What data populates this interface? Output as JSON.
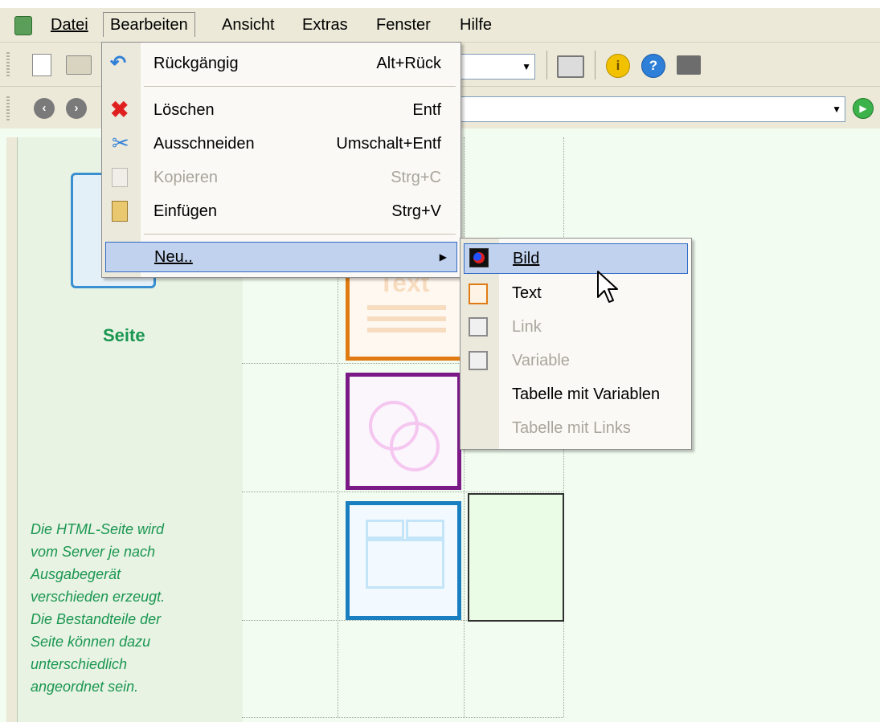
{
  "menubar": {
    "items": [
      {
        "label": "Datei"
      },
      {
        "label": "Bearbeiten"
      },
      {
        "label": "Ansicht"
      },
      {
        "label": "Extras"
      },
      {
        "label": "Fenster"
      },
      {
        "label": "Hilfe"
      }
    ]
  },
  "edit_menu": {
    "items": [
      {
        "label": "Rückgängig",
        "shortcut": "Alt+Rück",
        "icon": "undo-icon"
      },
      {
        "label": "Löschen",
        "shortcut": "Entf",
        "icon": "delete-icon"
      },
      {
        "label": "Ausschneiden",
        "shortcut": "Umschalt+Entf",
        "icon": "cut-icon"
      },
      {
        "label": "Kopieren",
        "shortcut": "Strg+C",
        "icon": "copy-icon",
        "disabled": true
      },
      {
        "label": "Einfügen",
        "shortcut": "Strg+V",
        "icon": "paste-icon"
      },
      {
        "label": "Neu..",
        "submenu_arrow": "▶"
      }
    ]
  },
  "new_submenu": {
    "items": [
      {
        "label": "Bild",
        "icon": "image-icon"
      },
      {
        "label": "Text",
        "icon": "text-icon"
      },
      {
        "label": "Link",
        "icon": "link-icon",
        "disabled": true
      },
      {
        "label": "Variable",
        "icon": "variable-icon",
        "disabled": true
      },
      {
        "label": "Tabelle mit Variablen"
      },
      {
        "label": "Tabelle mit Links",
        "disabled": true
      }
    ]
  },
  "left_panel": {
    "page_label": "Seite",
    "description": [
      "Die HTML-Seite wird",
      "vom Server je nach",
      "Ausgabegerät",
      "verschieden erzeugt.",
      "Die Bestandteile der",
      "Seite können dazu",
      "unterschiedlich",
      "angeordnet sein."
    ]
  },
  "canvas": {
    "text_tile_label": "Text"
  },
  "colors": {
    "accent_green": "#1a9650",
    "menu_highlight": "#c1d2ee",
    "text_tile_orange": "#e07b14",
    "link_tile_purple": "#7b1a86",
    "var_tile_blue": "#1a7fc0"
  }
}
